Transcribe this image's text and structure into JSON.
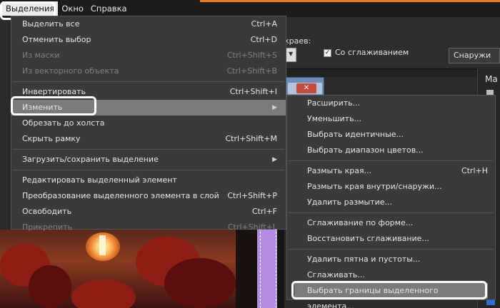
{
  "menubar": {
    "items": [
      "Выделения",
      "Окно",
      "Справка"
    ]
  },
  "options": {
    "edges_label": "краев:",
    "antialias_label": "Со сглаживанием",
    "antialias_checked": true,
    "outside_select": "Снаружи"
  },
  "right_panel": {
    "label": "Ma"
  },
  "doc": {
    "close_glyph": "✕"
  },
  "menu": {
    "items": [
      {
        "label": "Выделить все",
        "shortcut": "Ctrl+A",
        "disabled": false
      },
      {
        "label": "Отменить выбор",
        "shortcut": "Ctrl+D",
        "disabled": false
      },
      {
        "label": "Из маски",
        "shortcut": "Ctrl+Shift+S",
        "disabled": true
      },
      {
        "label": "Из векторного объекта",
        "shortcut": "Ctrl+Shift+B",
        "disabled": true
      },
      {
        "label": "Инвертировать",
        "shortcut": "Ctrl+Shift+I",
        "disabled": false
      },
      {
        "label": "Изменить",
        "shortcut": "",
        "disabled": false
      },
      {
        "label": "Обрезать до холста",
        "shortcut": "",
        "disabled": false
      },
      {
        "label": "Скрыть рамку",
        "shortcut": "Ctrl+Shift+M",
        "disabled": false
      },
      {
        "label": "Загрузить/сохранить выделение",
        "shortcut": "",
        "disabled": false
      },
      {
        "label": "Редактировать выделенный элемент",
        "shortcut": "",
        "disabled": false
      },
      {
        "label": "Преобразование выделенного элемента в слой",
        "shortcut": "Ctrl+Shift+P",
        "disabled": false
      },
      {
        "label": "Освободить",
        "shortcut": "Ctrl+F",
        "disabled": false
      },
      {
        "label": "Прикрепить",
        "shortcut": "Ctrl+Shift+L",
        "disabled": true
      }
    ]
  },
  "submenu": {
    "items": [
      {
        "label": "Расширить...",
        "shortcut": ""
      },
      {
        "label": "Уменьшить...",
        "shortcut": ""
      },
      {
        "label": "Выбрать идентичные...",
        "shortcut": ""
      },
      {
        "label": "Выбрать диапазон цветов...",
        "shortcut": ""
      },
      {
        "label": "Размыть края...",
        "shortcut": "Ctrl+H"
      },
      {
        "label": "Размыть края внутри/снаружи...",
        "shortcut": ""
      },
      {
        "label": "Удалить размытие...",
        "shortcut": ""
      },
      {
        "label": "Сглаживание по форме...",
        "shortcut": ""
      },
      {
        "label": "Восстановить сглаживание...",
        "shortcut": ""
      },
      {
        "label": "Удалить пятна и пустоты...",
        "shortcut": ""
      },
      {
        "label": "Сглаживать...",
        "shortcut": ""
      },
      {
        "label": "Выбрать границы выделенного элемента...",
        "shortcut": ""
      }
    ]
  },
  "colors": {
    "accent_orange": "#f07a1a",
    "menu_bg": "#3a3a3a",
    "highlight": "#7b7b7b",
    "annotation_outline": "#ffffff"
  }
}
